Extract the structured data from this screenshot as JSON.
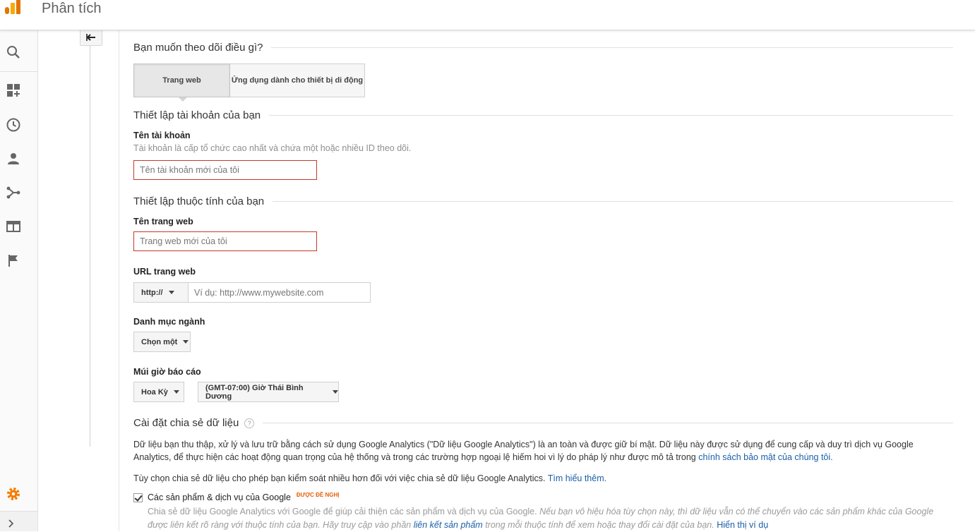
{
  "header": {
    "app_title": "Phân tích"
  },
  "rail": {
    "icons": [
      "search-icon",
      "dashboard-add-icon",
      "clock-icon",
      "person-icon",
      "acquisition-icon",
      "behavior-icon",
      "flag-icon",
      "gear-icon",
      "chevron-right-icon"
    ]
  },
  "form": {
    "track_question": "Bạn muốn theo dõi điều gì?",
    "track_options": [
      "Trang web",
      "Ứng dụng dành cho thiết bị di động"
    ],
    "account_section": "Thiết lập tài khoản của bạn",
    "account_name_label": "Tên tài khoản",
    "account_name_help": "Tài khoản là cấp tổ chức cao nhất và chứa một hoặc nhiều ID theo dõi.",
    "account_name_placeholder": "Tên tài khoản mới của tôi",
    "property_section": "Thiết lập thuộc tính của bạn",
    "site_name_label": "Tên trang web",
    "site_name_placeholder": "Trang web mới của tôi",
    "url_label": "URL trang web",
    "url_protocol": "http://",
    "url_placeholder": "Ví dụ: http://www.mywebsite.com",
    "industry_label": "Danh mục ngành",
    "industry_value": "Chọn một",
    "timezone_label": "Múi giờ báo cáo",
    "timezone_country": "Hoa Kỳ",
    "timezone_value": "(GMT-07:00) Giờ Thái Bình Dương",
    "sharing_section": "Cài đặt chia sẻ dữ liệu",
    "sharing_help_icon": "?"
  },
  "sharing": {
    "para1": "Dữ liệu bạn thu thập, xử lý và lưu trữ bằng cách sử dụng Google Analytics (\"Dữ liệu Google Analytics\") là an toàn và được giữ bí mật. Dữ liệu này được sử dụng để cung cấp và duy trì dịch vụ Google Analytics, để thực hiện các hoạt động quan trọng của hệ thống và trong các trường hợp ngoại lệ hiếm hoi vì lý do pháp lý như được mô tả trong",
    "privacy_link": "chính sách bảo mật của chúng tôi.",
    "para2": "Tùy chọn chia sẻ dữ liệu cho phép bạn kiểm soát nhiều hơn đối với việc chia sẻ dữ liệu Google Analytics.",
    "learn_more": "Tìm hiểu thêm.",
    "option1_label": "Các sản phẩm & dịch vụ của Google",
    "option1_badge": "ĐƯỢC ĐỀ NGHỊ",
    "option1_desc_a": "Chia sẻ dữ liệu Google Analytics với Google để giúp cải thiện các sản phẩm và dịch vụ của Google.",
    "option1_desc_b": "Nếu bạn vô hiệu hóa tùy chọn này, thì dữ liệu vẫn có thể chuyển vào các sản phẩm khác của Google được liên kết rõ ràng với thuộc tính của bạn. Hãy truy cập vào phần",
    "option1_link": "liên kết sản phẩm",
    "option1_desc_c": "trong mỗi thuộc tính để xem hoặc thay đổi cài đặt của bạn.",
    "option1_example": "Hiển thị ví dụ"
  },
  "colors": {
    "accent_orange": "#f57c00",
    "error_red": "#c53929",
    "link_blue": "#1a5fa8"
  }
}
